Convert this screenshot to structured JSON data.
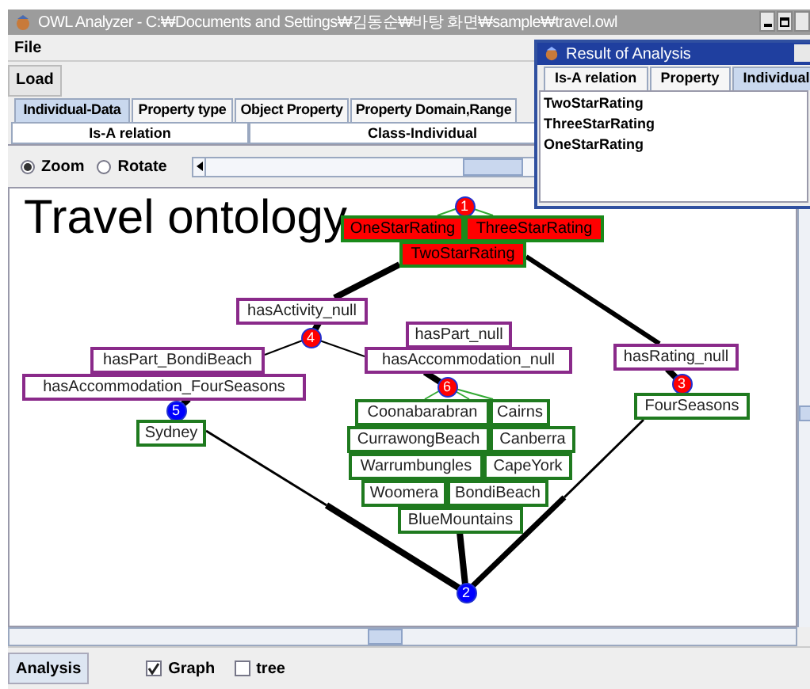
{
  "window": {
    "title": "OWL Analyzer - C:₩Documents and Settings₩김동순₩바탕 화면₩sample₩travel.owl"
  },
  "menu": [
    "File"
  ],
  "toolbar": {
    "load_button": "Load"
  },
  "tabs_row_1": [
    {
      "label": "Individual-Data",
      "selected": true
    },
    {
      "label": "Property type",
      "selected": false
    },
    {
      "label": "Object Property",
      "selected": false
    },
    {
      "label": "Property Domain,Range",
      "selected": false
    }
  ],
  "tabs_row_2": [
    {
      "label": "Is-A relation",
      "selected": false
    },
    {
      "label": "Class-Individual",
      "selected": false
    }
  ],
  "view_mode": [
    {
      "label": "Zoom",
      "selected": true
    },
    {
      "label": "Rotate",
      "selected": false
    }
  ],
  "zoom_slider": {
    "level": 0.47
  },
  "graph": {
    "title": "Travel ontology",
    "nodes": [
      {
        "kind": "marker",
        "label": "1",
        "color": "#ff0000"
      },
      {
        "kind": "class",
        "label": "OneStarRating"
      },
      {
        "kind": "class",
        "label": "ThreeStarRating"
      },
      {
        "kind": "class",
        "label": "TwoStarRating"
      },
      {
        "kind": "property",
        "label": "hasActivity_null"
      },
      {
        "kind": "property",
        "label": "hasPart_null"
      },
      {
        "kind": "marker",
        "label": "4",
        "color": "#ff0000"
      },
      {
        "kind": "property",
        "label": "hasPart_BondiBeach"
      },
      {
        "kind": "property",
        "label": "hasAccommodation_null"
      },
      {
        "kind": "property",
        "label": "hasRating_null"
      },
      {
        "kind": "property",
        "label": "hasAccommodation_FourSeasons"
      },
      {
        "kind": "marker",
        "label": "6",
        "color": "#ff0000"
      },
      {
        "kind": "marker",
        "label": "3",
        "color": "#ff0000"
      },
      {
        "kind": "marker",
        "label": "5",
        "color": "#0000ff"
      },
      {
        "kind": "individual",
        "label": "Sydney"
      },
      {
        "kind": "individual",
        "label": "Coonabarabran"
      },
      {
        "kind": "individual",
        "label": "Cairns"
      },
      {
        "kind": "individual",
        "label": "FourSeasons"
      },
      {
        "kind": "individual",
        "label": "CurrawongBeach"
      },
      {
        "kind": "individual",
        "label": "Canberra"
      },
      {
        "kind": "individual",
        "label": "Warrumbungles"
      },
      {
        "kind": "individual",
        "label": "CapeYork"
      },
      {
        "kind": "individual",
        "label": "Woomera"
      },
      {
        "kind": "individual",
        "label": "BondiBeach"
      },
      {
        "kind": "individual",
        "label": "BlueMountains"
      },
      {
        "kind": "marker",
        "label": "2",
        "color": "#0000ff"
      }
    ]
  },
  "bottom_bar": {
    "analysis_button": "Analysis",
    "options": [
      {
        "label": "Graph",
        "checked": true
      },
      {
        "label": "tree",
        "checked": false
      }
    ]
  },
  "result_window": {
    "title": "Result of Analysis",
    "tabs": [
      {
        "label": "Is-A relation",
        "selected": false
      },
      {
        "label": "Property",
        "selected": false
      },
      {
        "label": "Individual",
        "selected": true
      }
    ],
    "items": [
      "TwoStarRating",
      "ThreeStarRating",
      "OneStarRating"
    ]
  }
}
